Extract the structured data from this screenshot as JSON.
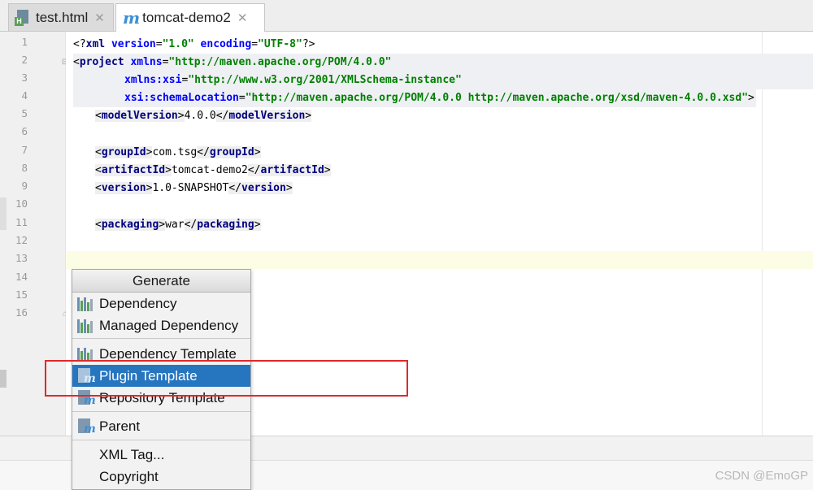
{
  "tabs": [
    {
      "label": "test.html",
      "icon": "html-file-icon",
      "active": false
    },
    {
      "label": "tomcat-demo2",
      "icon": "maven-icon",
      "active": true
    }
  ],
  "line_numbers": [
    "1",
    "2",
    "3",
    "4",
    "5",
    "6",
    "7",
    "8",
    "9",
    "10",
    "11",
    "12",
    "13",
    "14",
    "15",
    "16"
  ],
  "code": {
    "l1": {
      "open": "<?",
      "tag": "xml",
      "a1": " version",
      "eq1": "=",
      "v1": "\"1.0\"",
      "a2": " encoding",
      "eq2": "=",
      "v2": "\"UTF-8\"",
      "close": "?>"
    },
    "l2": {
      "open": "<",
      "tag": "project",
      "a1": " xmlns",
      "eq1": "=",
      "v1": "\"http://maven.apache.org/POM/4.0.0\""
    },
    "l3": {
      "a1": "xmlns:xsi",
      "eq1": "=",
      "v1": "\"http://www.w3.org/2001/XMLSchema-instance\""
    },
    "l4": {
      "a1": "xsi:schemaLocation",
      "eq1": "=",
      "v1": "\"http://maven.apache.org/POM/4.0.0 http://maven.apache.org/xsd/maven-4.0.0.xsd\"",
      "close": ">"
    },
    "l5": {
      "lt": "<",
      "tag": "modelVersion",
      "gt": ">",
      "text": "4.0.0",
      "lt2": "</",
      "tag2": "modelVersion",
      "gt2": ">"
    },
    "l7": {
      "lt": "<",
      "tag": "groupId",
      "gt": ">",
      "text": "com.tsg",
      "lt2": "</",
      "tag2": "groupId",
      "gt2": ">"
    },
    "l8": {
      "lt": "<",
      "tag": "artifactId",
      "gt": ">",
      "text": "tomcat-demo2",
      "lt2": "</",
      "tag2": "artifactId",
      "gt2": ">"
    },
    "l9": {
      "lt": "<",
      "tag": "version",
      "gt": ">",
      "text": "1.0-SNAPSHOT",
      "lt2": "</",
      "tag2": "version",
      "gt2": ">"
    },
    "l11": {
      "lt": "<",
      "tag": "packaging",
      "gt": ">",
      "text": "war",
      "lt2": "</",
      "tag2": "packaging",
      "gt2": ">"
    }
  },
  "popup": {
    "title": "Generate",
    "items": [
      {
        "label": "Dependency",
        "icon": "dependency-bars-icon",
        "selected": false
      },
      {
        "label": "Managed Dependency",
        "icon": "dependency-bars-icon",
        "selected": false
      },
      {
        "label": "Dependency Template",
        "icon": "dependency-bars-icon",
        "selected": false
      },
      {
        "label": "Plugin Template",
        "icon": "maven-file-icon",
        "selected": true
      },
      {
        "label": "Repository Template",
        "icon": "maven-file-icon",
        "selected": false
      },
      {
        "label": "Parent",
        "icon": "maven-file-icon",
        "selected": false
      },
      {
        "label": "XML Tag...",
        "icon": "",
        "selected": false
      },
      {
        "label": "Copyright",
        "icon": "",
        "selected": false
      }
    ]
  },
  "colors": {
    "selection": "#2675bf",
    "annotation_box": "#e0292b",
    "xml_tag": "#000080",
    "xml_attr": "#0000ff",
    "xml_value": "#008000"
  },
  "watermark": "CSDN @EmoGP"
}
